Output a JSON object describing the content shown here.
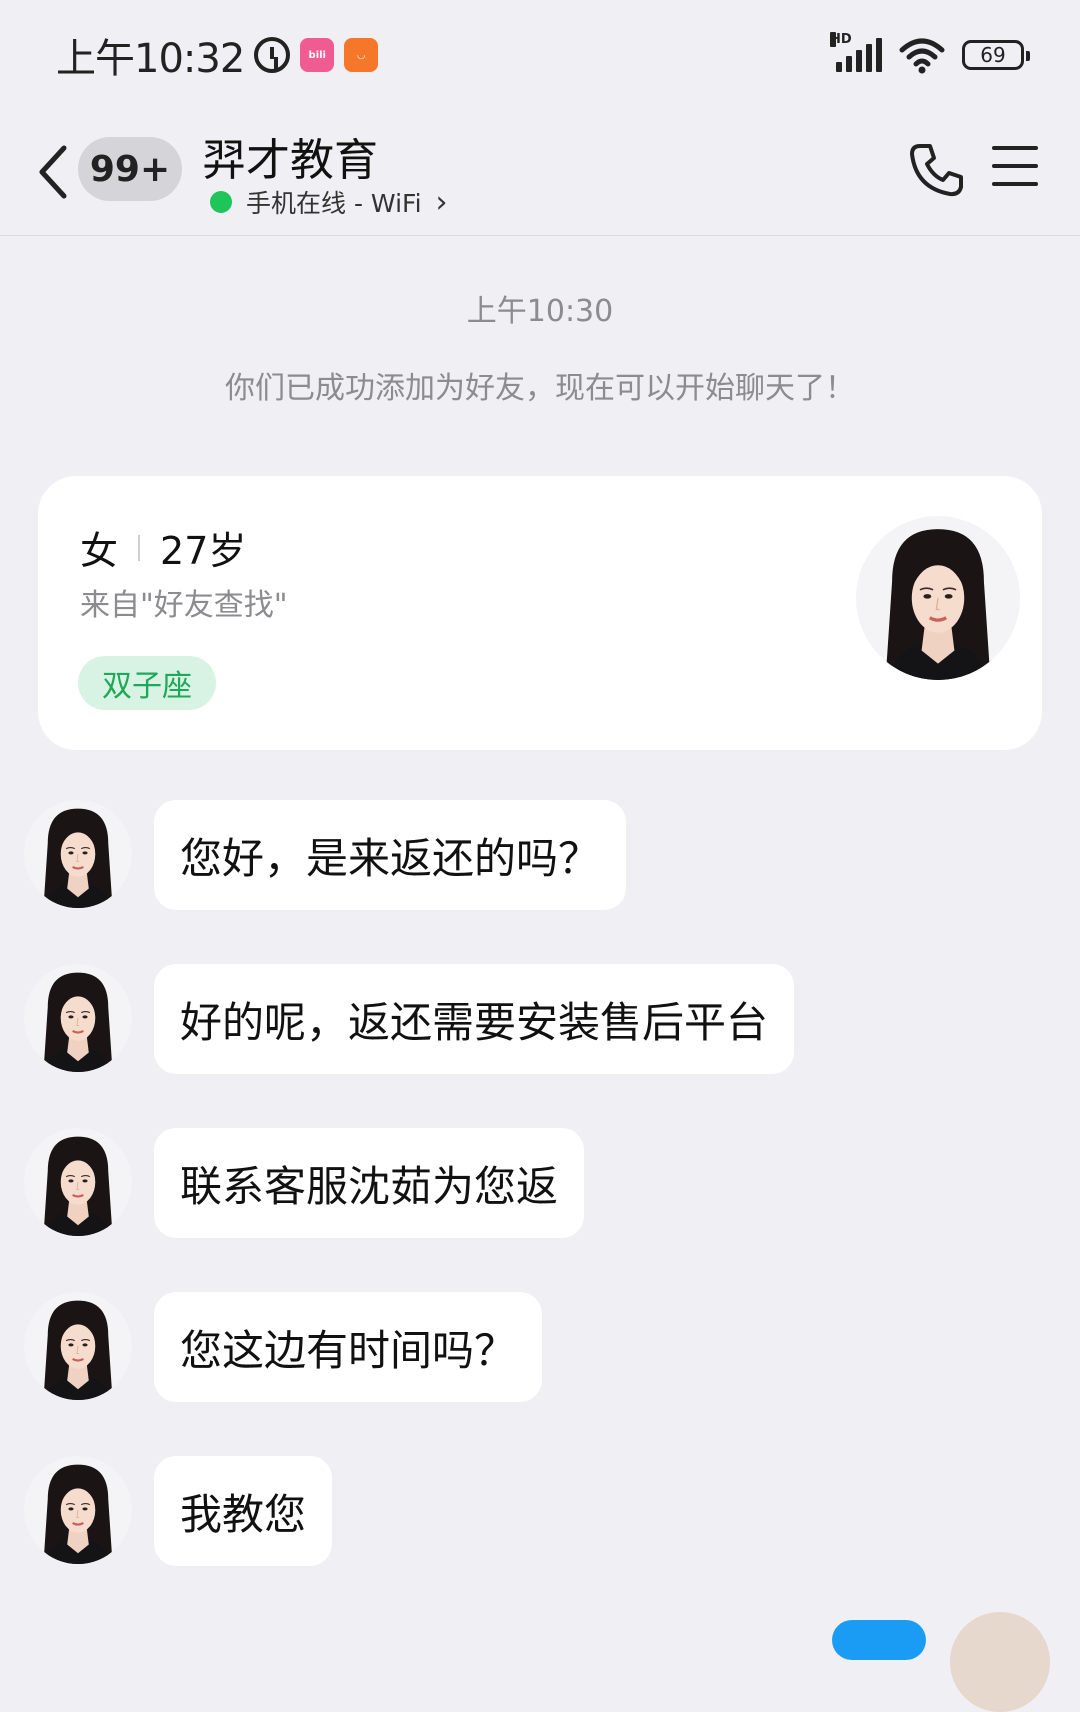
{
  "status_bar": {
    "time": "上午10:32",
    "battery": "69",
    "network": "HD"
  },
  "header": {
    "unread_badge": "99+",
    "title": "羿才教育",
    "status": "手机在线 - WiFi",
    "status_chevron": "›"
  },
  "chat": {
    "timestamp": "上午10:30",
    "system_notice": "你们已成功添加为好友，现在可以开始聊天了！",
    "profile_card": {
      "gender": "女",
      "age": "27岁",
      "source": "来自\"好友查找\"",
      "zodiac": "双子座"
    },
    "messages": [
      {
        "text": "您好，是来返还的吗？"
      },
      {
        "text": "好的呢，返还需要安装售后平台"
      },
      {
        "text": "联系客服沈茹为您返"
      },
      {
        "text": "您这边有时间吗？"
      },
      {
        "text": "我教您"
      }
    ]
  },
  "colors": {
    "online": "#20c55a",
    "zodiac_text": "#1fa858",
    "zodiac_bg": "#d8f3e3",
    "outgoing_bubble": "#1b9cf4",
    "background": "#efeff4"
  }
}
